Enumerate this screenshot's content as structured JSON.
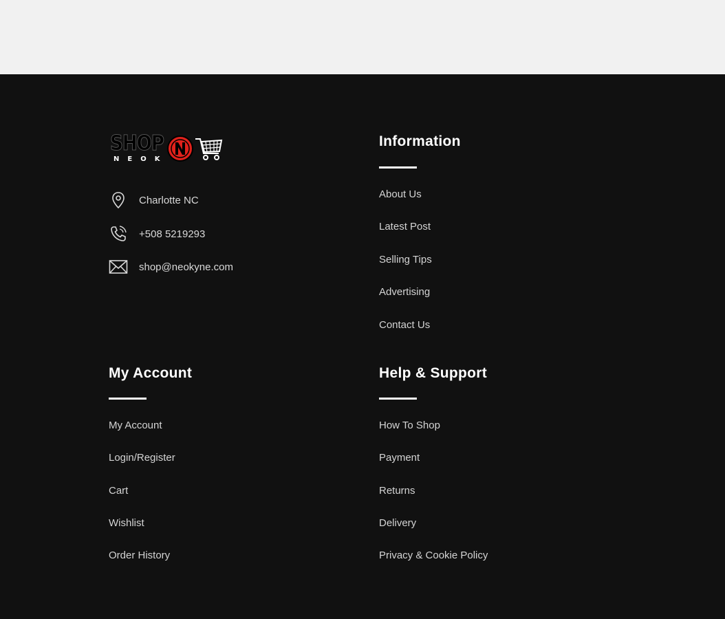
{
  "logo": {
    "main": "SHOP",
    "sub": "NEOK",
    "badge_letter": "N",
    "colors": {
      "badge_red": "#e0211b",
      "badge_ring": "#000000"
    }
  },
  "contact": [
    {
      "icon": "location-pin-icon",
      "text": "Charlotte NC"
    },
    {
      "icon": "phone-icon",
      "text": "+508 5219293"
    },
    {
      "icon": "envelope-icon",
      "text": "shop@neokyne.com"
    }
  ],
  "information": {
    "heading": "Information",
    "links": [
      "About Us",
      "Latest Post",
      "Selling Tips",
      "Advertising",
      "Contact Us"
    ]
  },
  "my_account": {
    "heading": "My Account",
    "links": [
      "My Account",
      "Login/Register",
      "Cart",
      "Wishlist",
      "Order History"
    ]
  },
  "help_support": {
    "heading": "Help & Support",
    "links": [
      "How To Shop",
      "Payment",
      "Returns",
      "Delivery",
      "Privacy & Cookie Policy"
    ]
  },
  "colors": {
    "top_band": "#f1f1f1",
    "footer_bg": "#111111",
    "heading": "#ffffff",
    "link": "#d4d4d4"
  }
}
